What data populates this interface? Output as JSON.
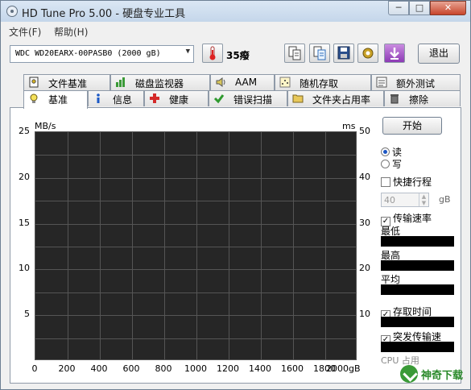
{
  "window": {
    "title": "HD Tune Pro 5.00 - 硬盘专业工具",
    "min": "─",
    "max": "□",
    "close": "✕"
  },
  "menu": {
    "file": "文件(F)",
    "help": "帮助(H)"
  },
  "toolbar": {
    "drive": "WDC     WD20EARX-00PASB0 (2000 gB)",
    "temperature": "35癈",
    "exit": "退出",
    "icons": [
      "copy-icon",
      "copy-text-icon",
      "save-icon",
      "settings-icon",
      "download-icon"
    ]
  },
  "tabs": {
    "row1": [
      "文件基准",
      "磁盘监视器",
      "AAM",
      "随机存取",
      "额外测试"
    ],
    "row2": [
      "基准",
      "信息",
      "健康",
      "错误扫描",
      "文件夹占用率",
      "擦除"
    ],
    "active": "基准"
  },
  "chart_data": {
    "type": "line",
    "ylabel_left": "MB/s",
    "ylabel_right": "ms",
    "yticks_left": [
      "25",
      "20",
      "15",
      "10",
      "5"
    ],
    "yticks_right": [
      "50",
      "40",
      "30",
      "20",
      "10"
    ],
    "xticks": [
      "0",
      "200",
      "400",
      "600",
      "800",
      "1000",
      "1200",
      "1400",
      "1600",
      "1800",
      "2000gB"
    ],
    "ylim_left": [
      0,
      25
    ],
    "ylim_right": [
      0,
      50
    ],
    "xlim": [
      0,
      2000
    ],
    "series": [],
    "grid": true,
    "background": "#262626"
  },
  "side": {
    "start": "开始",
    "read": "读",
    "write": "写",
    "short_stroke": "快捷行程",
    "short_stroke_value": "40",
    "short_stroke_unit": "gB",
    "transfer_rate": "传输速率",
    "min": "最低",
    "max": "最高",
    "avg": "平均",
    "access_time": "存取时间",
    "burst_rate": "突发传输速",
    "cpu": "CPU 占用"
  },
  "watermark": {
    "text": "神奇下载"
  }
}
